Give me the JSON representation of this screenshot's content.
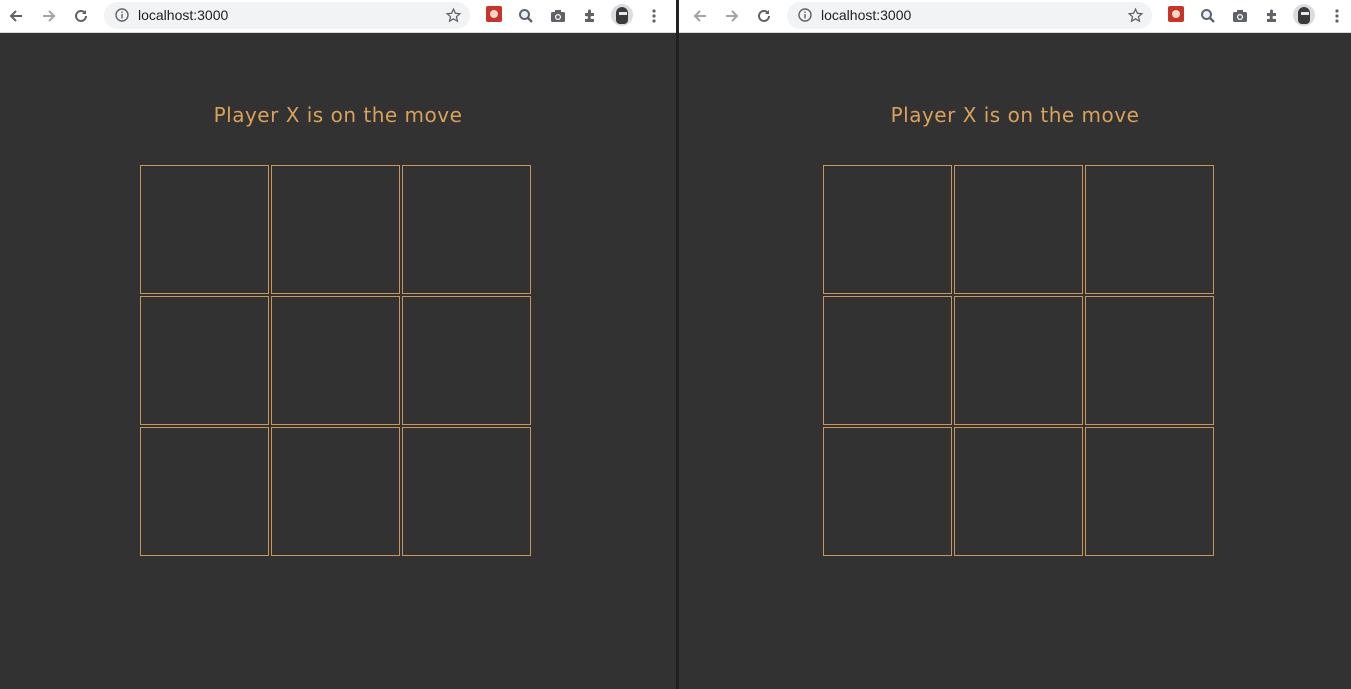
{
  "windows": [
    {
      "address_bar": {
        "url": "localhost:3000"
      },
      "game": {
        "status": "Player X is on the move",
        "board": [
          "",
          "",
          "",
          "",
          "",
          "",
          "",
          "",
          ""
        ]
      }
    },
    {
      "address_bar": {
        "url": "localhost:3000"
      },
      "game": {
        "status": "Player X is on the move",
        "board": [
          "",
          "",
          "",
          "",
          "",
          "",
          "",
          "",
          ""
        ]
      }
    }
  ],
  "theme": {
    "background": "#313231",
    "accent": "#d9a15c",
    "cell_border": "#c8955a"
  },
  "toolbar_icons": [
    "back-arrow-icon",
    "forward-arrow-icon",
    "reload-icon",
    "info-icon",
    "star-icon",
    "extension-red-icon",
    "zoom-icon",
    "camera-icon",
    "puzzle-icon",
    "profile-avatar",
    "kebab-menu-icon"
  ]
}
